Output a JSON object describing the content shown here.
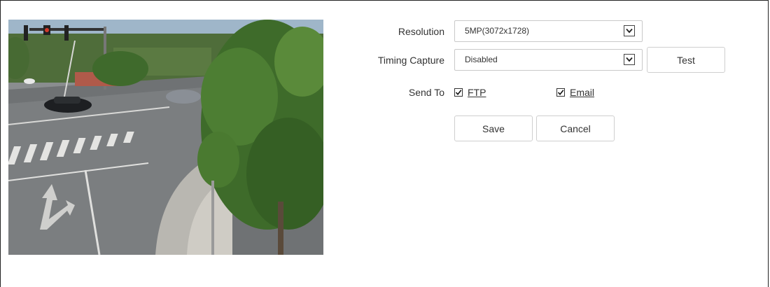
{
  "preview": {
    "description_icon": "camera-snapshot-image"
  },
  "form": {
    "resolution": {
      "label": "Resolution",
      "value": "5MP(3072x1728)"
    },
    "timing_capture": {
      "label": "Timing Capture",
      "value": "Disabled",
      "test_label": "Test"
    },
    "send_to": {
      "label": "Send To",
      "ftp_label": "FTP",
      "ftp_checked": true,
      "email_label": "Email",
      "email_checked": true
    },
    "actions": {
      "save_label": "Save",
      "cancel_label": "Cancel"
    }
  }
}
